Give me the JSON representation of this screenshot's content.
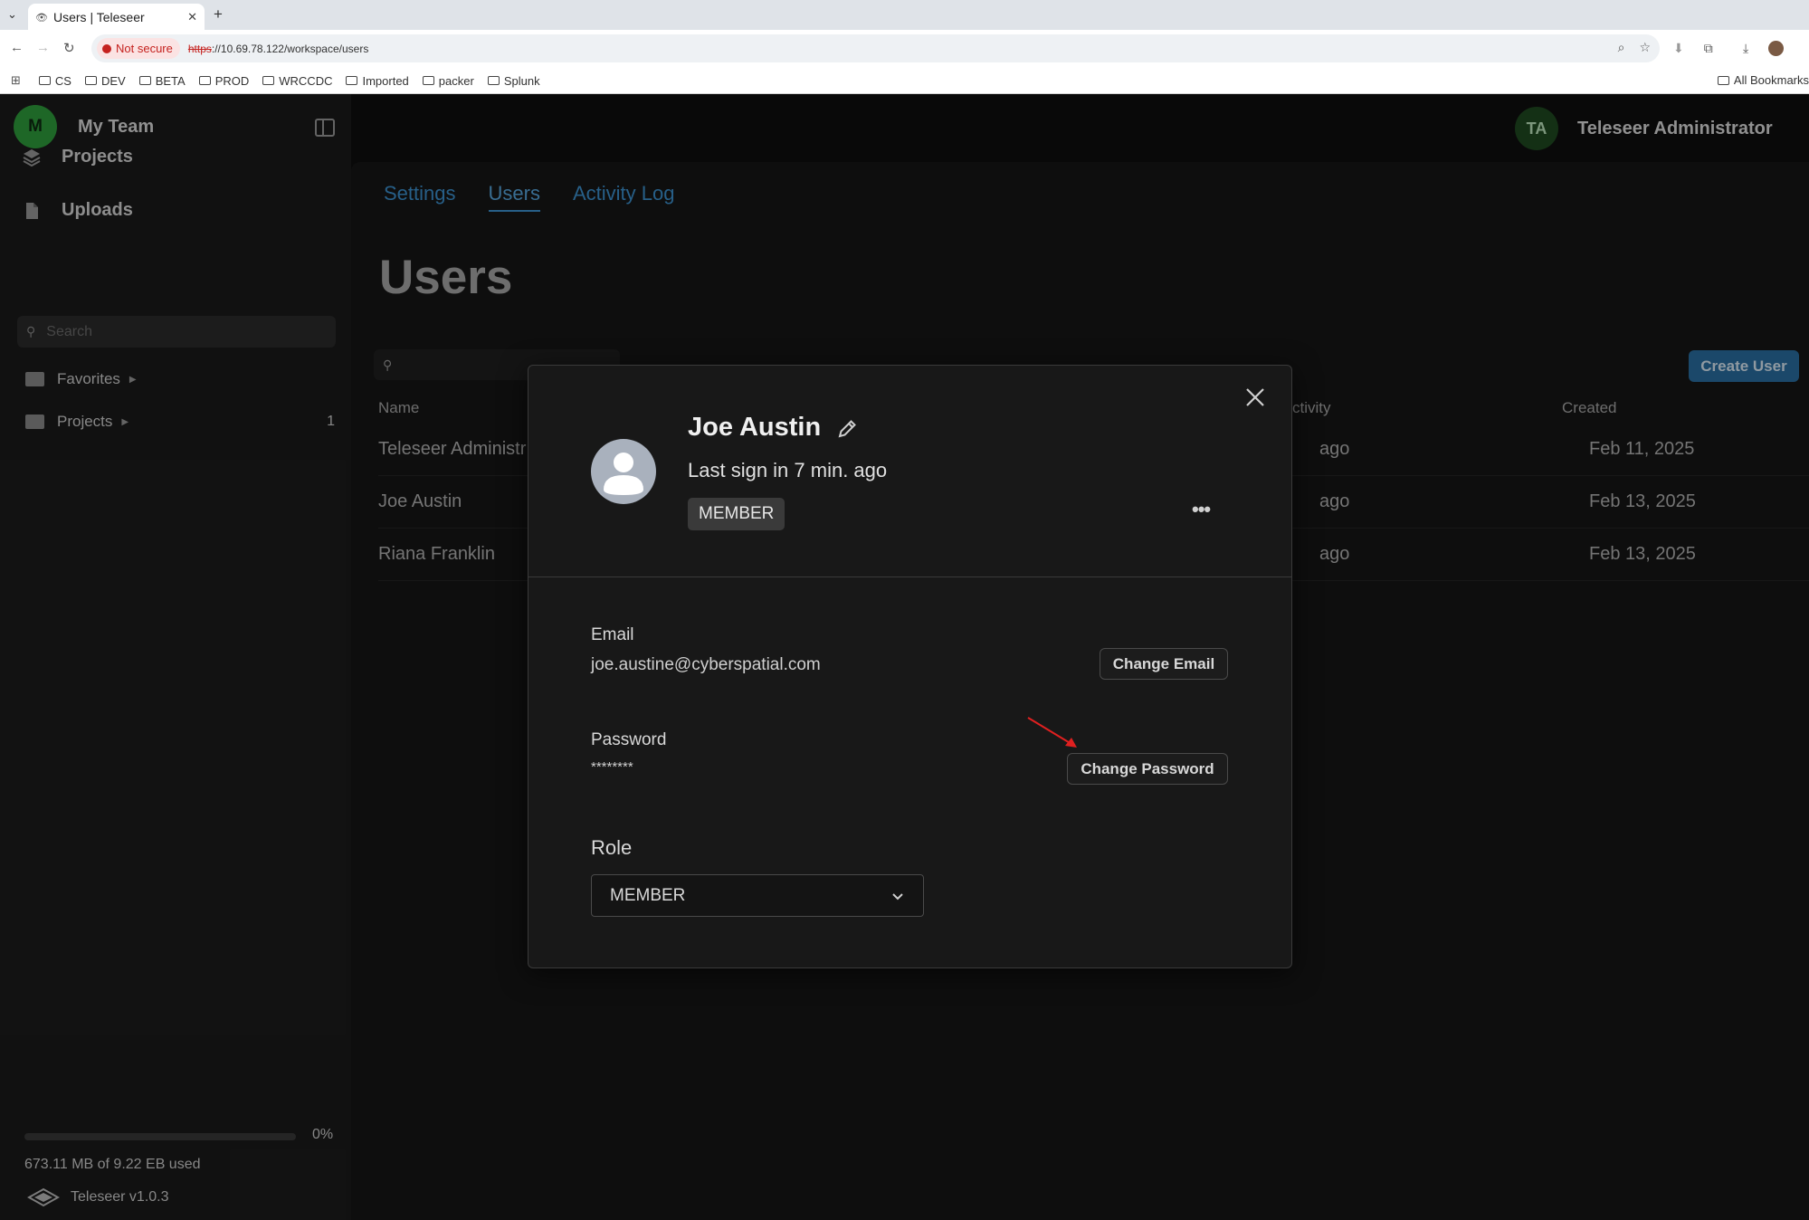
{
  "browser": {
    "tab_title": "Users | Teleseer",
    "security_label": "Not secure",
    "url_protocol": "https",
    "url_rest": "://10.69.78.122/workspace/users",
    "bookmarks": [
      "CS",
      "DEV",
      "BETA",
      "PROD",
      "WRCCDC",
      "Imported",
      "packer",
      "Splunk"
    ],
    "all_bookmarks": "All Bookmarks"
  },
  "sidebar": {
    "team_initial": "M",
    "team_name": "My Team",
    "nav": [
      {
        "label": "Projects",
        "icon": "layers-icon"
      },
      {
        "label": "Uploads",
        "icon": "file-icon"
      }
    ],
    "search_placeholder": "Search",
    "tree": [
      {
        "label": "Favorites",
        "count": ""
      },
      {
        "label": "Projects",
        "count": "1"
      }
    ],
    "usage_percent": "0%",
    "usage_fraction": 0,
    "usage_text": "673.11 MB of 9.22 EB used",
    "version": "Teleseer v1.0.3"
  },
  "header": {
    "user_initials": "TA",
    "user_name": "Teleseer Administrator"
  },
  "main": {
    "tabs": [
      {
        "label": "Settings",
        "active": false
      },
      {
        "label": "Users",
        "active": true
      },
      {
        "label": "Activity Log",
        "active": false
      }
    ],
    "page_title": "Users",
    "create_button": "Create User",
    "columns": {
      "name": "Name",
      "activity": "ctivity",
      "created": "Created"
    },
    "rows": [
      {
        "name": "Teleseer Administr",
        "activity": "ago",
        "created": "Feb 11, 2025"
      },
      {
        "name": "Joe Austin",
        "activity": "ago",
        "created": "Feb 13, 2025"
      },
      {
        "name": "Riana Franklin",
        "activity": "ago",
        "created": "Feb 13, 2025"
      }
    ]
  },
  "modal": {
    "name": "Joe Austin",
    "last_sign": "Last sign in 7 min. ago",
    "role_badge": "MEMBER",
    "email_label": "Email",
    "email_value": "joe.austine@cyberspatial.com",
    "change_email": "Change Email",
    "password_label": "Password",
    "password_value": "********",
    "change_password": "Change Password",
    "role_label": "Role",
    "role_value": "MEMBER"
  },
  "colors": {
    "accent": "#3d93d1",
    "create_button": "#2a6fa3",
    "team_avatar": "#2f9e3c",
    "annotation_arrow": "#e02020"
  }
}
